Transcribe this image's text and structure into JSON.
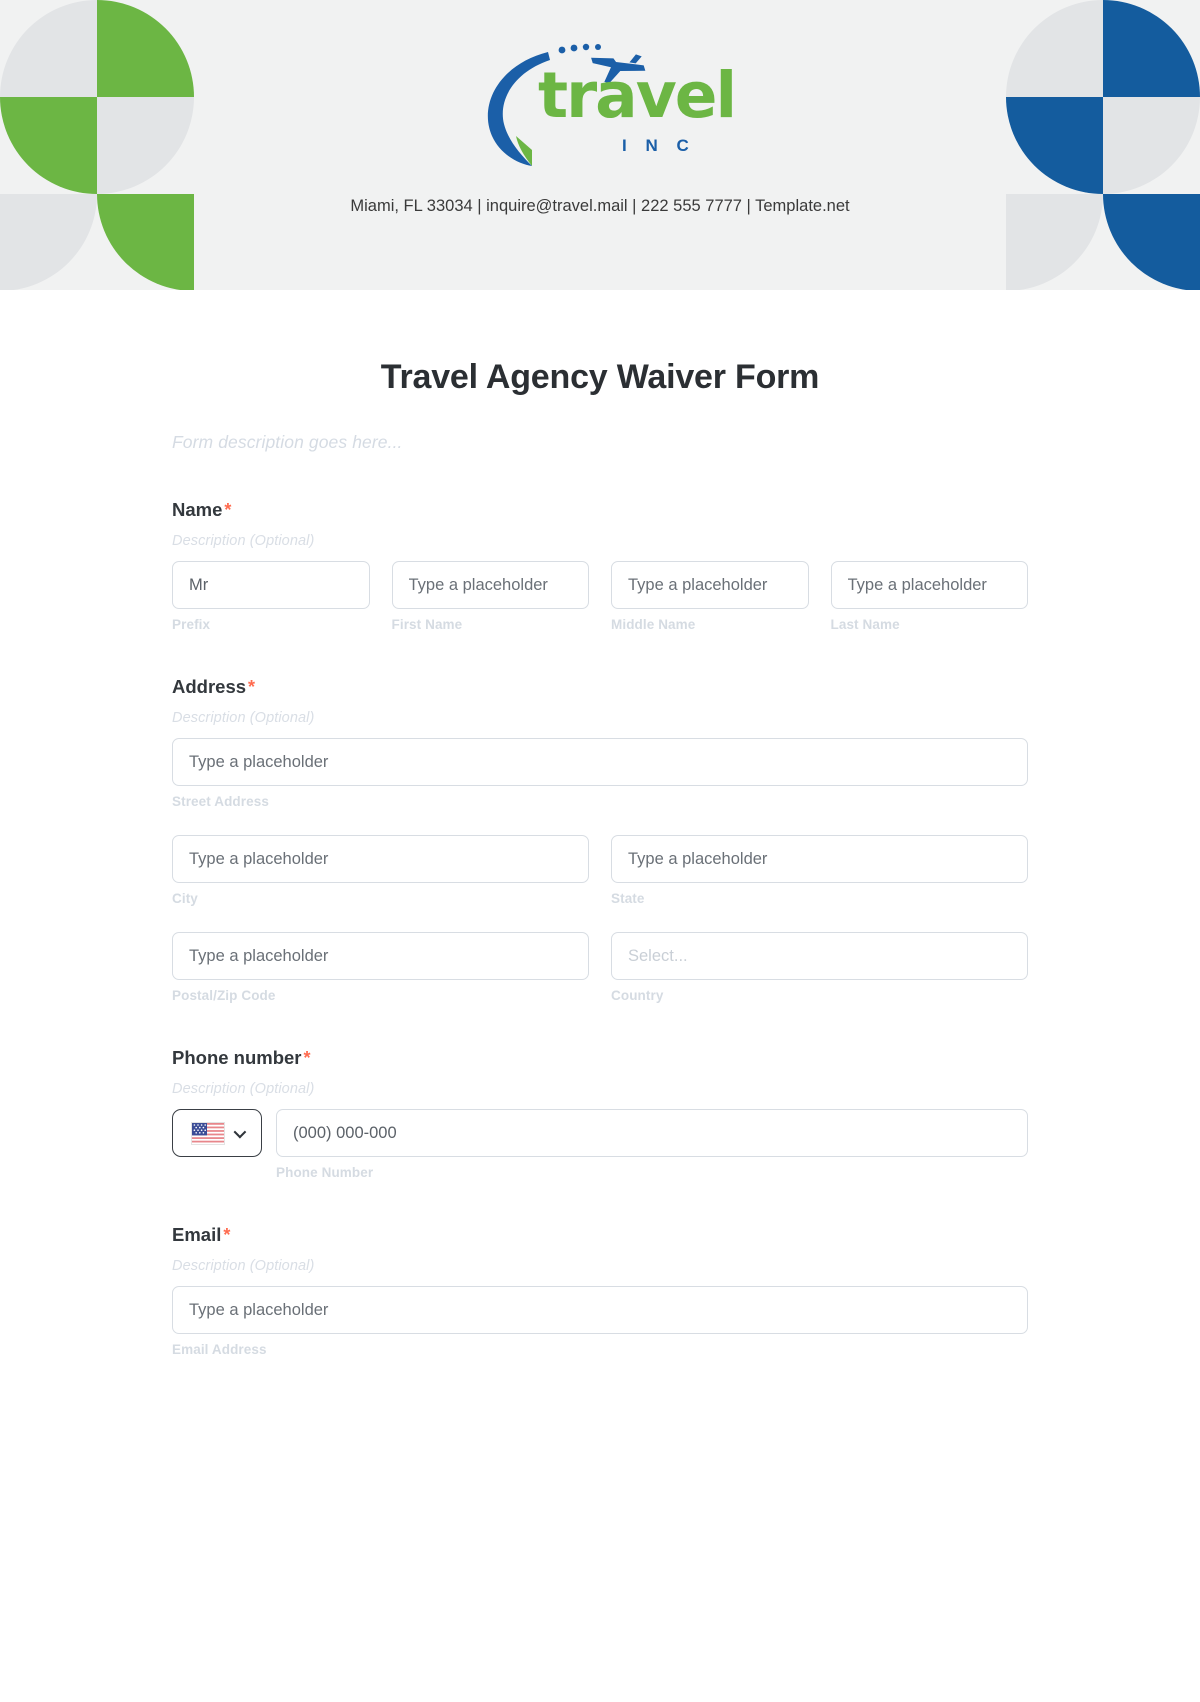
{
  "banner": {
    "logo": {
      "word": "travel",
      "sub": "I N C",
      "plane_icon": "airplane-swoosh-icon",
      "word_color": "#6cb644",
      "sub_color": "#1b5fa8"
    },
    "contact": "Miami, FL 33034 | inquire@travel.mail | 222 555 7777 | Template.net",
    "decor": {
      "left_color": "#6cb644",
      "right_color": "#145c9e",
      "neutral_color": "#e2e4e6",
      "bg_color": "#f1f2f2"
    }
  },
  "form": {
    "title": "Travel Agency Waiver Form",
    "description": "Form description goes here...",
    "required_marker": "*",
    "accent_required_color": "#ff6b4f",
    "sections": [
      {
        "label": "Name",
        "required": true,
        "description": "Description (Optional)",
        "fields": [
          {
            "value": "Mr",
            "placeholder": "Mr",
            "sublabel": "Prefix"
          },
          {
            "value": "",
            "placeholder": "Type a placeholder",
            "sublabel": "First Name"
          },
          {
            "value": "",
            "placeholder": "Type a placeholder",
            "sublabel": "Middle Name"
          },
          {
            "value": "",
            "placeholder": "Type a placeholder",
            "sublabel": "Last Name"
          }
        ]
      },
      {
        "label": "Address",
        "required": true,
        "description": "Description (Optional)",
        "street": {
          "placeholder": "Type a placeholder",
          "sublabel": "Street Address"
        },
        "city": {
          "placeholder": "Type a placeholder",
          "sublabel": "City"
        },
        "state": {
          "placeholder": "Type a placeholder",
          "sublabel": "State"
        },
        "zip": {
          "placeholder": "Type a placeholder",
          "sublabel": "Postal/Zip Code"
        },
        "country": {
          "placeholder": "Select...",
          "sublabel": "Country"
        }
      },
      {
        "label": "Phone number",
        "required": true,
        "description": "Description (Optional)",
        "country_flag": "us-flag-icon",
        "dropdown_icon": "chevron-down-icon",
        "phone": {
          "placeholder": "(000) 000-000",
          "sublabel": "Phone Number"
        }
      },
      {
        "label": "Email",
        "required": true,
        "description": "Description (Optional)",
        "email": {
          "placeholder": "Type a placeholder",
          "sublabel": "Email Address"
        }
      }
    ]
  }
}
